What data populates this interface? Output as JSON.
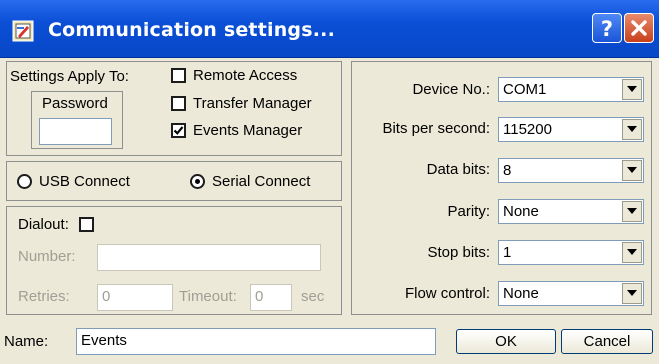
{
  "window": {
    "title": "Communication settings..."
  },
  "apply_group": {
    "label": "Settings Apply To:",
    "password_label": "Password",
    "password_value": "",
    "options": [
      {
        "label": "Remote Access",
        "checked": false
      },
      {
        "label": "Transfer Manager",
        "checked": false
      },
      {
        "label": "Events Manager",
        "checked": true
      }
    ]
  },
  "connect_group": {
    "usb_label": "USB Connect",
    "serial_label": "Serial Connect",
    "selected": "serial"
  },
  "dialout_group": {
    "dialout_label": "Dialout:",
    "dialout_checked": false,
    "number_label": "Number:",
    "number_value": "",
    "retries_label": "Retries:",
    "retries_value": "0",
    "timeout_label": "Timeout:",
    "timeout_value": "0",
    "timeout_unit": "sec"
  },
  "port_settings": {
    "device_label": "Device No.:",
    "device_value": "COM1",
    "bps_label": "Bits per second:",
    "bps_value": "115200",
    "databits_label": "Data bits:",
    "databits_value": "8",
    "parity_label": "Parity:",
    "parity_value": "None",
    "stopbits_label": "Stop bits:",
    "stopbits_value": "1",
    "flow_label": "Flow control:",
    "flow_value": "None"
  },
  "footer": {
    "name_label": "Name:",
    "name_value": "Events",
    "ok_label": "OK",
    "cancel_label": "Cancel"
  },
  "colors": {
    "titlebar": "#0a4fd6",
    "face": "#ece9d8",
    "close": "#c8401c"
  }
}
